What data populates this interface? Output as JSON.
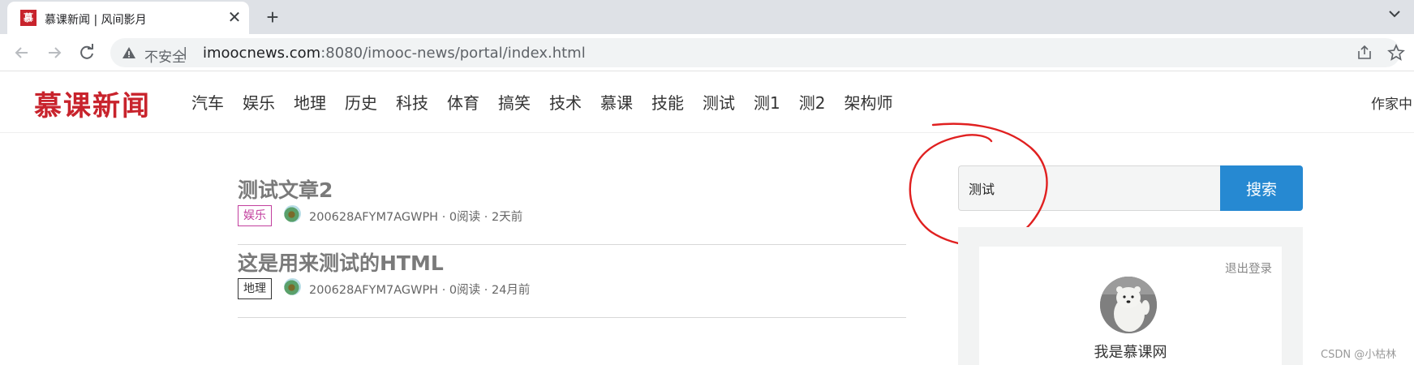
{
  "browser": {
    "tab_title": "慕课新闻 | 风间影月",
    "favicon_text": "慕",
    "close_glyph": "✕",
    "new_tab_glyph": "+",
    "security_label": "不安全",
    "separator": "|",
    "url_host": "imoocnews.com",
    "url_rest": ":8080/imooc-news/portal/index.html"
  },
  "header": {
    "logo": "慕课新闻",
    "nav": [
      "汽车",
      "娱乐",
      "地理",
      "历史",
      "科技",
      "体育",
      "搞笑",
      "技术",
      "慕课",
      "技能",
      "测试",
      "测1",
      "测2",
      "架构师"
    ],
    "author_center": "作家中"
  },
  "articles": [
    {
      "title": "测试文章2",
      "tag": "娱乐",
      "meta": "200628AFYM7AGWPH · 0阅读 · 2天前"
    },
    {
      "title": "这是用来测试的HTML",
      "tag": "地理",
      "meta": "200628AFYM7AGWPH · 0阅读 · 24月前"
    }
  ],
  "search": {
    "value": "测试",
    "button_label": "搜索"
  },
  "profile": {
    "logout_label": "退出登录",
    "name": "我是慕课网"
  },
  "watermark": "CSDN @小枯林",
  "colors": {
    "brand_red": "#c8232c",
    "search_blue": "#2689d2",
    "tag_entertainment": "#c23f9e",
    "annotation_red": "#e02020"
  }
}
